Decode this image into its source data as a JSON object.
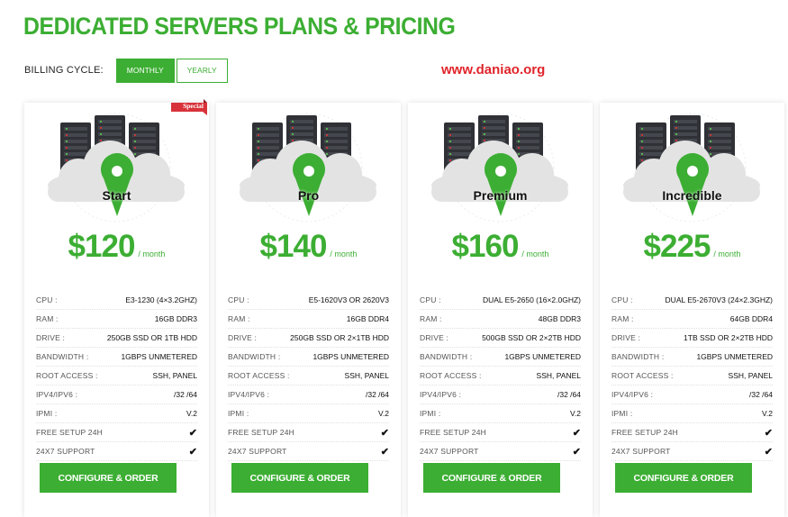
{
  "page": {
    "title": "DEDICATED SERVERS PLANS & PRICING",
    "watermark": "www.daniao.org"
  },
  "billing": {
    "label": "BILLING CYCLE:",
    "options": [
      "MONTHLY",
      "YEARLY"
    ],
    "selected": "MONTHLY"
  },
  "colors": {
    "accent": "#3cae33",
    "ribbon": "#d8323a",
    "watermark": "#e0242a"
  },
  "icons": [
    "server-rack-icon",
    "cloud-icon",
    "map-pin-icon",
    "check-icon"
  ],
  "plans": [
    {
      "name": "Start",
      "price": "$120",
      "period": "/ month",
      "badge": "Special",
      "specs": [
        {
          "label": "CPU :",
          "value": "E3-1230 (4×3.2GHZ)"
        },
        {
          "label": "RAM :",
          "value": "16GB DDR3"
        },
        {
          "label": "DRIVE :",
          "value": "250GB SSD OR 1TB HDD"
        },
        {
          "label": "BANDWIDTH :",
          "value": "1GBPS UNMETERED"
        },
        {
          "label": "ROOT ACCESS :",
          "value": "SSH, PANEL"
        },
        {
          "label": "IPV4/IPV6 :",
          "value": "/32 /64"
        },
        {
          "label": "IPMI :",
          "value": "V.2"
        },
        {
          "label": "FREE SETUP 24H",
          "value": "✔"
        },
        {
          "label": "24X7 SUPPORT",
          "value": "✔"
        }
      ],
      "button": "CONFIGURE & ORDER"
    },
    {
      "name": "Pro",
      "price": "$140",
      "period": "/ month",
      "specs": [
        {
          "label": "CPU :",
          "value": "E5-1620V3 OR 2620V3"
        },
        {
          "label": "RAM :",
          "value": "16GB DDR4"
        },
        {
          "label": "DRIVE :",
          "value": "250GB SSD OR 2×1TB HDD"
        },
        {
          "label": "BANDWIDTH :",
          "value": "1GBPS UNMETERED"
        },
        {
          "label": "ROOT ACCESS :",
          "value": "SSH, PANEL"
        },
        {
          "label": "IPV4/IPV6 :",
          "value": "/32 /64"
        },
        {
          "label": "IPMI :",
          "value": "V.2"
        },
        {
          "label": "FREE SETUP 24H",
          "value": "✔"
        },
        {
          "label": "24X7 SUPPORT",
          "value": "✔"
        }
      ],
      "button": "CONFIGURE & ORDER"
    },
    {
      "name": "Premium",
      "price": "$160",
      "period": "/ month",
      "specs": [
        {
          "label": "CPU :",
          "value": "DUAL E5-2650 (16×2.0GHZ)"
        },
        {
          "label": "RAM :",
          "value": "48GB DDR3"
        },
        {
          "label": "DRIVE :",
          "value": "500GB SSD OR 2×2TB HDD"
        },
        {
          "label": "BANDWIDTH :",
          "value": "1GBPS UNMETERED"
        },
        {
          "label": "ROOT ACCESS :",
          "value": "SSH, PANEL"
        },
        {
          "label": "IPV4/IPV6 :",
          "value": "/32 /64"
        },
        {
          "label": "IPMI :",
          "value": "V.2"
        },
        {
          "label": "FREE SETUP 24H",
          "value": "✔"
        },
        {
          "label": "24X7 SUPPORT",
          "value": "✔"
        }
      ],
      "button": "CONFIGURE & ORDER"
    },
    {
      "name": "Incredible",
      "price": "$225",
      "period": "/ month",
      "specs": [
        {
          "label": "CPU :",
          "value": "DUAL E5-2670V3 (24×2.3GHZ)"
        },
        {
          "label": "RAM :",
          "value": "64GB DDR4"
        },
        {
          "label": "DRIVE :",
          "value": "1TB SSD OR 2×2TB HDD"
        },
        {
          "label": "BANDWIDTH :",
          "value": "1GBPS UNMETERED"
        },
        {
          "label": "ROOT ACCESS :",
          "value": "SSH, PANEL"
        },
        {
          "label": "IPV4/IPV6 :",
          "value": "/32 /64"
        },
        {
          "label": "IPMI :",
          "value": "V.2"
        },
        {
          "label": "FREE SETUP 24H",
          "value": "✔"
        },
        {
          "label": "24X7 SUPPORT",
          "value": "✔"
        }
      ],
      "button": "CONFIGURE & ORDER"
    }
  ]
}
